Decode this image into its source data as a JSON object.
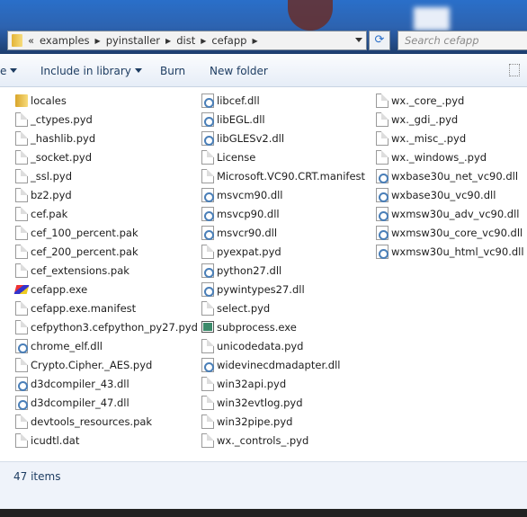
{
  "address": {
    "crumbs": [
      "examples",
      "pyinstaller",
      "dist",
      "cefapp"
    ],
    "overflow": "«"
  },
  "search": {
    "placeholder": "Search cefapp"
  },
  "toolbar": {
    "organize": "e",
    "include": "Include in library",
    "burn": "Burn",
    "new_folder": "New folder"
  },
  "files": [
    [
      [
        "locales",
        "folder"
      ],
      [
        "_ctypes.pyd",
        "file"
      ],
      [
        "_hashlib.pyd",
        "file"
      ],
      [
        "_socket.pyd",
        "file"
      ],
      [
        "_ssl.pyd",
        "file"
      ],
      [
        "bz2.pyd",
        "file"
      ],
      [
        "cef.pak",
        "file"
      ],
      [
        "cef_100_percent.pak",
        "file"
      ],
      [
        "cef_200_percent.pak",
        "file"
      ],
      [
        "cef_extensions.pak",
        "file"
      ],
      [
        "cefapp.exe",
        "exe"
      ],
      [
        "cefapp.exe.manifest",
        "file"
      ],
      [
        "cefpython3.cefpython_py27.pyd",
        "file"
      ],
      [
        "chrome_elf.dll",
        "dll"
      ],
      [
        "Crypto.Cipher._AES.pyd",
        "file"
      ],
      [
        "d3dcompiler_43.dll",
        "dll"
      ],
      [
        "d3dcompiler_47.dll",
        "dll"
      ],
      [
        "devtools_resources.pak",
        "file"
      ],
      [
        "icudtl.dat",
        "file"
      ]
    ],
    [
      [
        "libcef.dll",
        "dll"
      ],
      [
        "libEGL.dll",
        "dll"
      ],
      [
        "libGLESv2.dll",
        "dll"
      ],
      [
        "License",
        "file"
      ],
      [
        "Microsoft.VC90.CRT.manifest",
        "file"
      ],
      [
        "msvcm90.dll",
        "dll"
      ],
      [
        "msvcp90.dll",
        "dll"
      ],
      [
        "msvcr90.dll",
        "dll"
      ],
      [
        "pyexpat.pyd",
        "file"
      ],
      [
        "python27.dll",
        "dll"
      ],
      [
        "pywintypes27.dll",
        "dll"
      ],
      [
        "select.pyd",
        "file"
      ],
      [
        "subprocess.exe",
        "winexe"
      ],
      [
        "unicodedata.pyd",
        "file"
      ],
      [
        "widevinecdmadapter.dll",
        "dll"
      ],
      [
        "win32api.pyd",
        "file"
      ],
      [
        "win32evtlog.pyd",
        "file"
      ],
      [
        "win32pipe.pyd",
        "file"
      ],
      [
        "wx._controls_.pyd",
        "file"
      ]
    ],
    [
      [
        "wx._core_.pyd",
        "file"
      ],
      [
        "wx._gdi_.pyd",
        "file"
      ],
      [
        "wx._misc_.pyd",
        "file"
      ],
      [
        "wx._windows_.pyd",
        "file"
      ],
      [
        "wxbase30u_net_vc90.dll",
        "dll"
      ],
      [
        "wxbase30u_vc90.dll",
        "dll"
      ],
      [
        "wxmsw30u_adv_vc90.dll",
        "dll"
      ],
      [
        "wxmsw30u_core_vc90.dll",
        "dll"
      ],
      [
        "wxmsw30u_html_vc90.dll",
        "dll"
      ]
    ]
  ],
  "status": {
    "count": "47 items"
  }
}
